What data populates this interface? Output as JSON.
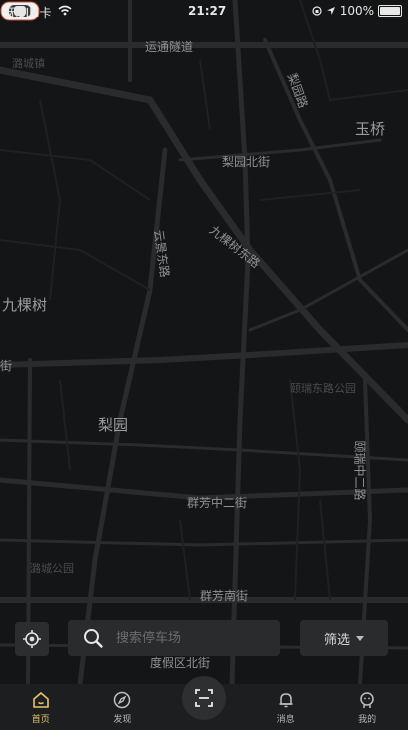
{
  "status_bar": {
    "carrier": "无SIM卡",
    "time": "21:27",
    "battery": "100%"
  },
  "map": {
    "labels": {
      "yuntong": "运通隧道",
      "liyuanlu": "梨园路",
      "yuqiao": "玉桥",
      "liyuan_north": "梨园北街",
      "jiukeshu_east": "九棵树东路",
      "yunjing_east": "云景东路",
      "jiukeshu": "九棵树",
      "liyuan": "梨园",
      "yirui": "颐瑞中二路",
      "qunfang2": "群芳中二街",
      "qunfang_south": "群芳南街",
      "dujia_north": "度假区北街",
      "faint_park": "潞城公园",
      "faint_top": "潞城镇",
      "faint_right": "颐瑞东路公园",
      "edge_left": "街"
    }
  },
  "search": {
    "placeholder": "搜索停车场"
  },
  "filter": {
    "label": "筛选"
  },
  "tabs": [
    {
      "label": "首页",
      "icon": "home-icon"
    },
    {
      "label": "发现",
      "icon": "compass-icon"
    },
    {
      "label": "",
      "icon": "scan-icon"
    },
    {
      "label": "消息",
      "icon": "bell-icon"
    },
    {
      "label": "我的",
      "icon": "user-icon"
    }
  ],
  "colors": {
    "active_tab": "#e7c66a",
    "map_bg": "#141516",
    "road": "#2b2c2e"
  }
}
